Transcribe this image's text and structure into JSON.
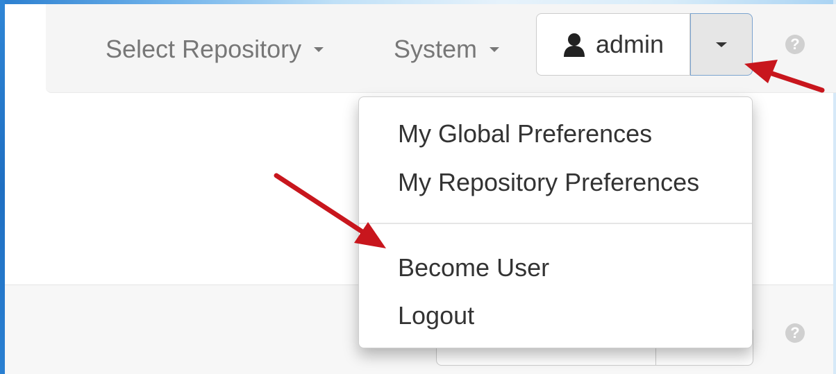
{
  "navbar": {
    "select_repository": "Select Repository",
    "system": "System",
    "user_label": "admin",
    "icons": {
      "user": "user-icon",
      "caret": "chevron-down-icon",
      "help": "help-icon"
    }
  },
  "user_menu": {
    "items": [
      "My Global Preferences",
      "My Repository Preferences",
      "Become User",
      "Logout"
    ]
  },
  "help_glyph": "?",
  "colors": {
    "annotation_arrow": "#c8161d",
    "toggle_border": "#7aa3cf",
    "navbar_bg": "#f5f5f5"
  }
}
